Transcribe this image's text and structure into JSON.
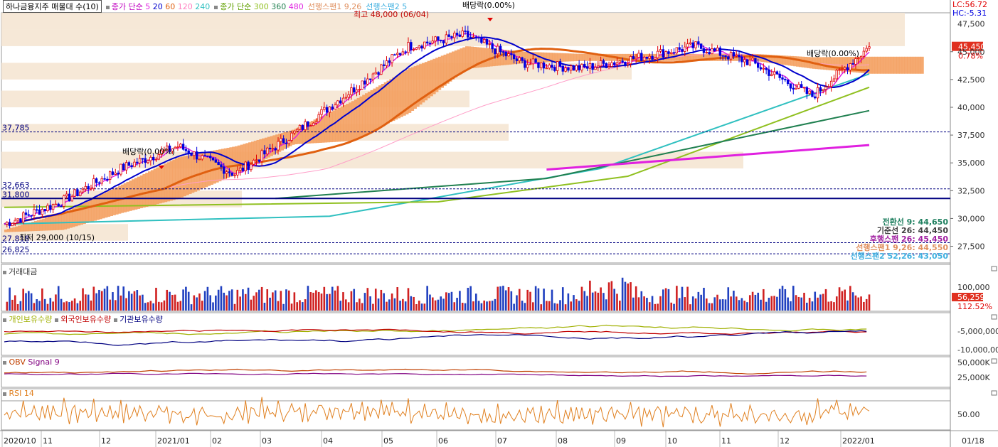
{
  "header": {
    "security": "하나금융지주 매물대 수(10)",
    "ma_label": "종가 단순",
    "ma_periods": [
      {
        "value": "5",
        "color": "#e020e0"
      },
      {
        "value": "20",
        "color": "#0000cc"
      },
      {
        "value": "60",
        "color": "#e06010"
      },
      {
        "value": "120",
        "color": "#ff80c0"
      },
      {
        "value": "240",
        "color": "#30c0c0"
      }
    ],
    "ma2_label": "종가 단순",
    "ma2_periods": [
      {
        "value": "300",
        "color": "#90c020"
      },
      {
        "value": "360",
        "color": "#208050"
      },
      {
        "value": "480",
        "color": "#e020e0"
      }
    ],
    "span_labels": [
      "선행스팬1 9,26",
      "선행스팬2 5"
    ]
  },
  "corner": {
    "lc": "LC:56.72",
    "hc": "HC:-5.31"
  },
  "main_chart": {
    "annotations": {
      "dividend_top": "배당락(0.00%)",
      "high": "최고 48,000 (06/04)",
      "dividend_mid": "배당락(0.00%)",
      "dividend_right": "배당락(0.00%)",
      "low": "최저 29,000 (10/15)"
    },
    "left_levels": [
      "37,785",
      "32,663",
      "31,800",
      "27,818",
      "26,825"
    ],
    "price_axis": [
      "45,000",
      "42,500",
      "40,000",
      "37,500",
      "35,000",
      "32,500",
      "30,000",
      "27,500"
    ],
    "current_price": "45,450",
    "current_change": "0.78%",
    "top_tick": "47,500",
    "ichimoku_legend": [
      {
        "label": "전환선 9: 44,650",
        "color": "#208060"
      },
      {
        "label": "기준선 26: 44,450",
        "color": "#404040"
      },
      {
        "label": "후행스팬 26: 45,450",
        "color": "#a020a0"
      },
      {
        "label": "선행스팬1 9,26: 44,550",
        "color": "#e09060"
      },
      {
        "label": "선행스팬2 52,26: 43,050",
        "color": "#40b0e0"
      }
    ]
  },
  "volume_panel": {
    "title": "거래대금",
    "axis": "100,000",
    "current": "56,259",
    "percent": "112.52%"
  },
  "holdings_panel": {
    "legends": [
      {
        "label": "개인보유수량",
        "color": "#a0b000"
      },
      {
        "label": "외국인보유수량",
        "color": "#c00000"
      },
      {
        "label": "기관보유수량",
        "color": "#000080"
      }
    ],
    "axis": [
      "-5,000,000",
      "-10,000,00"
    ]
  },
  "obv_panel": {
    "title": "OBV",
    "signal": "Signal 9",
    "axis": [
      "50,000K",
      "25,000K"
    ]
  },
  "rsi_panel": {
    "title": "RSI 14",
    "axis": "50.00"
  },
  "time_axis": [
    "2020/10",
    "11",
    "12",
    "2021/01",
    "02",
    "03",
    "04",
    "05",
    "06",
    "07",
    "08",
    "09",
    "10",
    "11",
    "12",
    "2022/01"
  ],
  "time_axis_right": "01/18",
  "chart_data": {
    "type": "line",
    "title": "하나금융지주",
    "x": [
      "2020/10",
      "11",
      "12",
      "2021/01",
      "02",
      "03",
      "04",
      "05",
      "06",
      "07",
      "08",
      "09",
      "10",
      "11",
      "12",
      "2022/01"
    ],
    "series": [
      {
        "name": "종가",
        "values": [
          29500,
          31500,
          34500,
          36500,
          34000,
          37500,
          41500,
          45500,
          46500,
          44000,
          43500,
          44500,
          45500,
          44000,
          41000,
          45450
        ]
      },
      {
        "name": "선행스팬1 9,26",
        "values": [
          29000,
          30500,
          33000,
          35500,
          36500,
          38000,
          40500,
          43500,
          45500,
          45000,
          44800,
          44800,
          44800,
          44800,
          44500,
          44550
        ]
      },
      {
        "name": "선행스팬2 52,26",
        "values": [
          28800,
          29000,
          30500,
          31800,
          34000,
          36700,
          37000,
          39500,
          43500,
          44000,
          44200,
          44200,
          44200,
          44200,
          43500,
          43050
        ]
      }
    ],
    "ylim": [
      26000,
      48500
    ],
    "price_levels": [
      37785,
      32663,
      31800,
      27818,
      26825
    ],
    "high": {
      "value": 48000,
      "date": "06/04"
    },
    "low": {
      "value": 29000,
      "date": "10/15"
    },
    "current": 45450
  }
}
